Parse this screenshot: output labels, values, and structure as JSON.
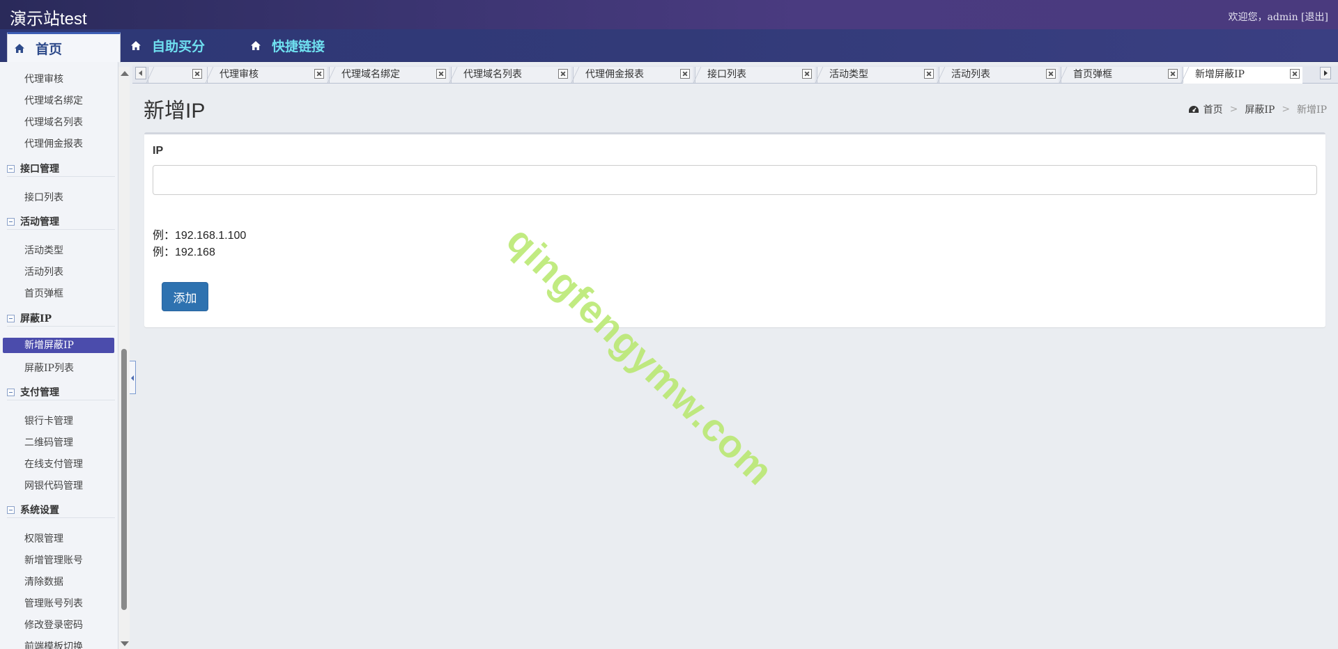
{
  "header": {
    "app_title": "演示站test",
    "welcome_prefix": "欢迎您，admin [",
    "logout_label": "退出",
    "welcome_suffix": "]"
  },
  "nav": {
    "items": [
      {
        "label": "首页",
        "icon": "home-icon"
      },
      {
        "label": "自助买分",
        "icon": "home-icon"
      },
      {
        "label": "快捷链接",
        "icon": "home-icon"
      }
    ]
  },
  "sidebar": {
    "items": [
      {
        "type": "item",
        "label": "代理审核"
      },
      {
        "type": "item",
        "label": "代理域名绑定"
      },
      {
        "type": "item",
        "label": "代理域名列表"
      },
      {
        "type": "item",
        "label": "代理佣金报表"
      },
      {
        "type": "group",
        "label": "接口管理"
      },
      {
        "type": "item",
        "label": "接口列表"
      },
      {
        "type": "group",
        "label": "活动管理"
      },
      {
        "type": "item",
        "label": "活动类型"
      },
      {
        "type": "item",
        "label": "活动列表"
      },
      {
        "type": "item",
        "label": "首页弹框"
      },
      {
        "type": "group",
        "label": "屏蔽IP"
      },
      {
        "type": "item",
        "label": "新增屏蔽IP",
        "active": true
      },
      {
        "type": "item",
        "label": "屏蔽IP列表"
      },
      {
        "type": "group",
        "label": "支付管理"
      },
      {
        "type": "item",
        "label": "银行卡管理"
      },
      {
        "type": "item",
        "label": "二维码管理"
      },
      {
        "type": "item",
        "label": "在线支付管理"
      },
      {
        "type": "item",
        "label": "网银代码管理"
      },
      {
        "type": "group",
        "label": "系统设置"
      },
      {
        "type": "item",
        "label": "权限管理"
      },
      {
        "type": "item",
        "label": "新增管理账号"
      },
      {
        "type": "item",
        "label": "清除数据"
      },
      {
        "type": "item",
        "label": "管理账号列表"
      },
      {
        "type": "item",
        "label": "修改登录密码"
      },
      {
        "type": "item",
        "label": "前端模板切换"
      }
    ]
  },
  "tabs": [
    {
      "label": ""
    },
    {
      "label": "代理审核"
    },
    {
      "label": "代理域名绑定"
    },
    {
      "label": "代理域名列表"
    },
    {
      "label": "代理佣金报表"
    },
    {
      "label": "接口列表"
    },
    {
      "label": "活动类型"
    },
    {
      "label": "活动列表"
    },
    {
      "label": "首页弹框"
    },
    {
      "label": "新增屏蔽IP",
      "active": true
    }
  ],
  "page": {
    "title": "新增IP",
    "breadcrumb": {
      "home": "首页",
      "parent": "屏蔽IP",
      "current": "新增IP",
      "sep": ">"
    }
  },
  "form": {
    "ip_label": "IP",
    "ip_value": "",
    "example1": "例：192.168.1.100",
    "example2": "例：192.168",
    "submit_label": "添加"
  },
  "watermark": "qingfengymw.com",
  "colors": {
    "header_bg": "#3a3470",
    "nav_text": "#6fe0f0",
    "active_sidebar": "#4b4cac",
    "primary_button": "#2e72b0",
    "watermark": "#b7e86c"
  }
}
